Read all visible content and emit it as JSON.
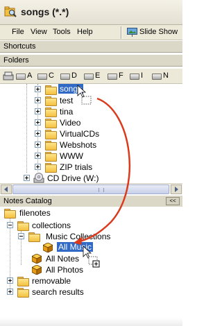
{
  "window": {
    "title": "songs (*.*)",
    "app_icon": "folder-magnifier-icon"
  },
  "menu": {
    "items": [
      "File",
      "View",
      "Tools",
      "Help"
    ],
    "slideshow_label": "Slide Show",
    "slideshow_icon": "slideshow-icon"
  },
  "shortcuts": {
    "title": "Shortcuts"
  },
  "folders": {
    "title": "Folders",
    "drives": [
      "A",
      "C",
      "D",
      "E",
      "F",
      "I",
      "N"
    ],
    "tree": [
      {
        "label": "songs",
        "selected": true
      },
      {
        "label": "test"
      },
      {
        "label": "tina"
      },
      {
        "label": "Video"
      },
      {
        "label": "VirtualCDs"
      },
      {
        "label": "Webshots"
      },
      {
        "label": "WWW"
      },
      {
        "label": "ZIP trials"
      }
    ],
    "cd_drive": "CD Drive (W:)"
  },
  "notes_catalog": {
    "title": "Notes Catalog",
    "collapse_button": "<<",
    "tree": {
      "root": "filenotes",
      "collections": "collections",
      "music_collections": "Music Collections",
      "all_music": "All Music",
      "all_notes": "All Notes",
      "all_photos": "All Photos",
      "removable": "removable",
      "search_results": "search results"
    }
  },
  "colors": {
    "selection": "#316ac5",
    "arrow": "#d93b1c",
    "folder": "#f3c040",
    "cube": "#e8a21a"
  }
}
